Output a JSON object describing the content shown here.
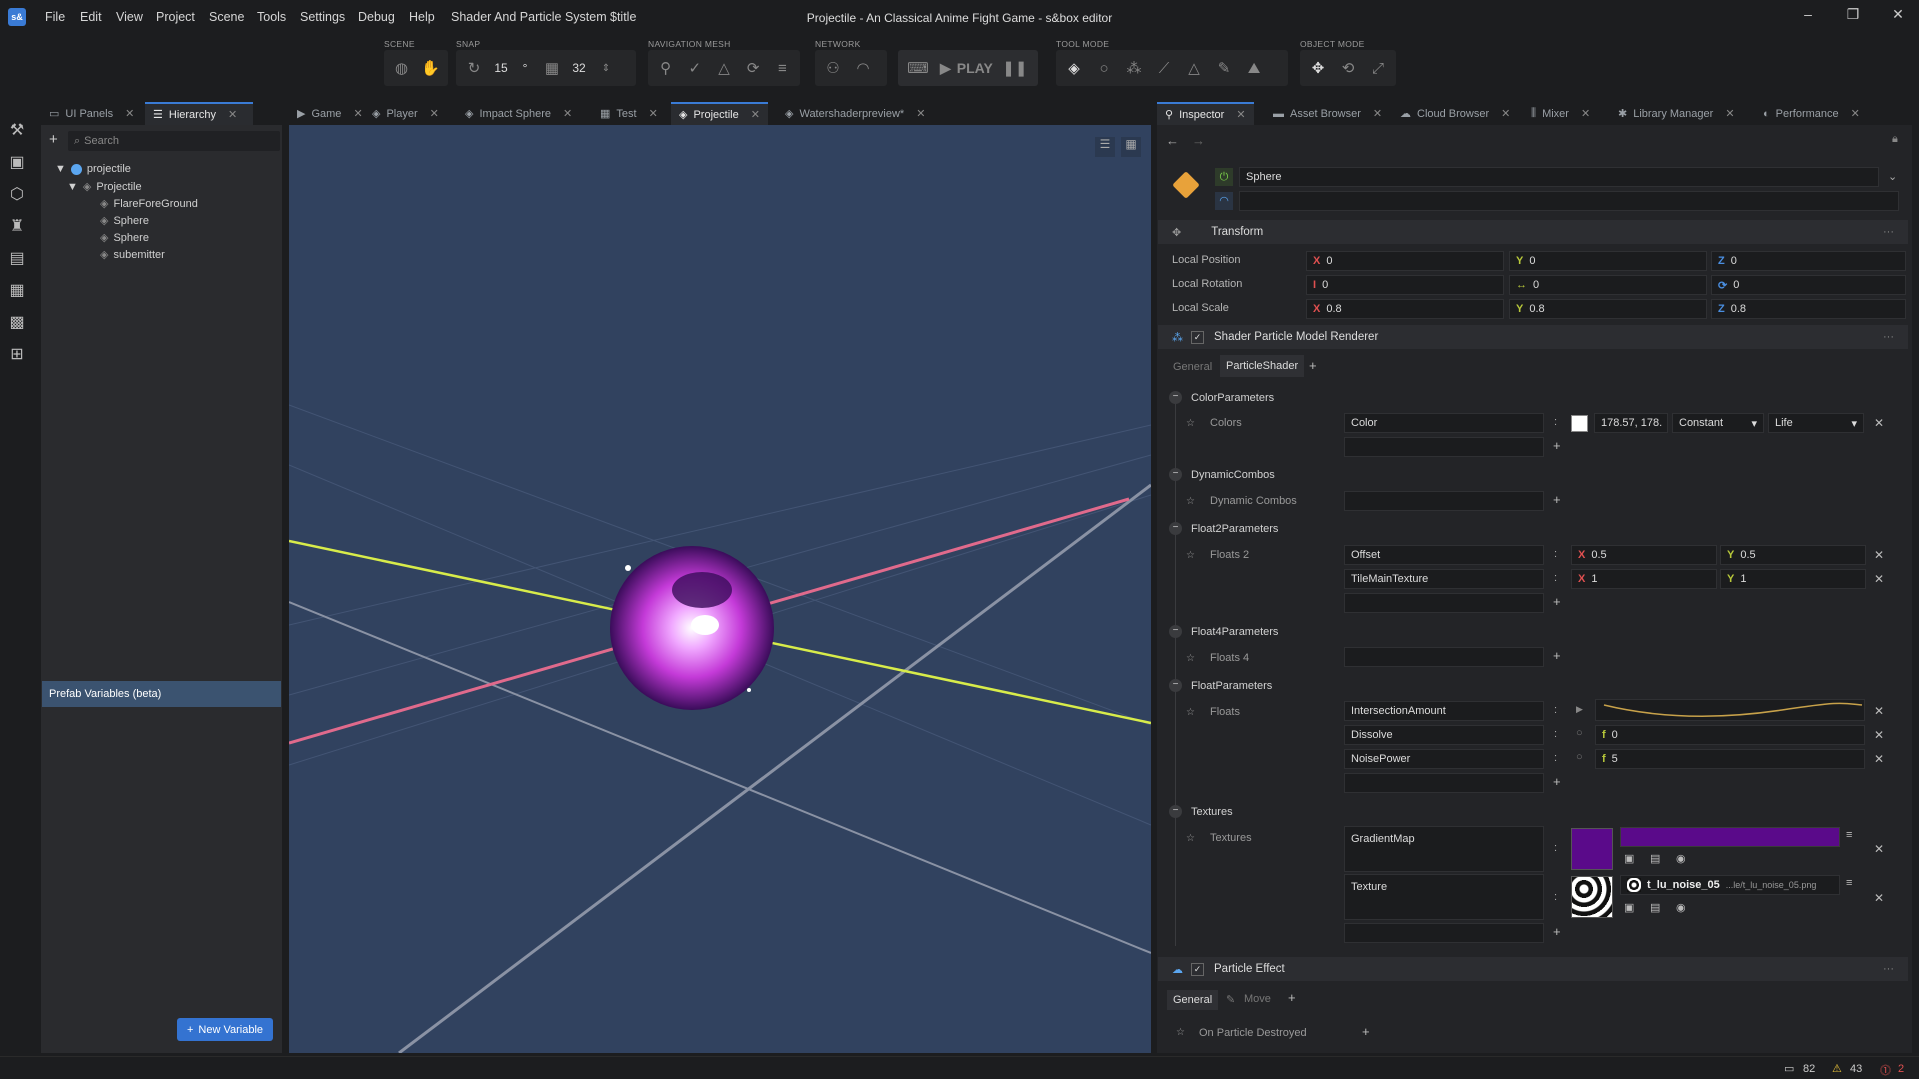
{
  "app": {
    "logo": "s&",
    "title": "Projectile - An Classical Anime Fight Game - s&box editor"
  },
  "menu": [
    "File",
    "Edit",
    "View",
    "Project",
    "Scene",
    "Tools",
    "Settings",
    "Debug",
    "Help",
    "Shader And Particle System",
    "$title"
  ],
  "window_controls": {
    "minimize": "–",
    "maximize": "❐",
    "close": "✕"
  },
  "toolbar": {
    "scene_label": "SCENE",
    "snap_label": "SNAP",
    "snap_angle": "15",
    "snap_deg": "°",
    "snap_grid": "32",
    "navmesh_label": "NAVIGATION MESH",
    "network_label": "NETWORK",
    "play_label": "PLAY",
    "toolmode_label": "TOOL MODE",
    "objectmode_label": "OBJECT MODE"
  },
  "left_tabs": [
    {
      "label": "UI Panels"
    },
    {
      "label": "Hierarchy"
    }
  ],
  "hierarchy": {
    "search_placeholder": "Search",
    "items": [
      "projectile",
      "Projectile",
      "FlareForeGround",
      "Sphere",
      "Sphere",
      "subemitter"
    ],
    "prefab_variables": "Prefab Variables (beta)",
    "new_variable": "New Variable"
  },
  "center_tabs": [
    "Game",
    "Player",
    "Impact Sphere",
    "Test",
    "Projectile",
    "Watershaderpreview*"
  ],
  "right_tabs": [
    "Inspector",
    "Asset Browser",
    "Cloud Browser",
    "Mixer",
    "Library Manager",
    "Performance"
  ],
  "inspector": {
    "object_name": "Sphere",
    "transform": {
      "title": "Transform",
      "rows": [
        {
          "label": "Local Position",
          "x": "0",
          "y": "0",
          "z": "0"
        },
        {
          "label": "Local Rotation",
          "x": "0",
          "y": "0",
          "z": "0"
        },
        {
          "label": "Local Scale",
          "x": "0.8",
          "y": "0.8",
          "z": "0.8"
        }
      ]
    },
    "renderer": {
      "title": "Shader Particle Model Renderer",
      "tabs": [
        "General",
        "ParticleShader"
      ],
      "color_params": {
        "title": "ColorParameters",
        "label": "Colors",
        "name": "Color",
        "value": "178.57, 178.",
        "mode": "Constant",
        "life": "Life"
      },
      "dynamic": {
        "title": "DynamicCombos",
        "label": "Dynamic Combos"
      },
      "float2": {
        "title": "Float2Parameters",
        "label": "Floats 2",
        "rows": [
          {
            "name": "Offset",
            "x": "0.5",
            "y": "0.5"
          },
          {
            "name": "TileMainTexture",
            "x": "1",
            "y": "1"
          }
        ]
      },
      "float4": {
        "title": "Float4Parameters",
        "label": "Floats 4"
      },
      "float": {
        "title": "FloatParameters",
        "label": "Floats",
        "rows": [
          {
            "name": "IntersectionAmount"
          },
          {
            "name": "Dissolve",
            "f": "f",
            "value": "0"
          },
          {
            "name": "NoisePower",
            "f": "f",
            "value": "5"
          }
        ]
      },
      "textures": {
        "title": "Textures",
        "label": "Textures",
        "rows": [
          {
            "name": "GradientMap"
          },
          {
            "name": "Texture",
            "file": "t_lu_noise_05",
            "path": "...le/t_lu_noise_05.png"
          }
        ]
      }
    },
    "particle_effect": {
      "title": "Particle Effect",
      "tabs": [
        "General",
        "Move"
      ],
      "on_destroyed": "On Particle Destroyed"
    }
  },
  "status": {
    "messages": "82",
    "warnings": "43",
    "errors": "2"
  },
  "colors": {
    "accent": "#3a7bd5",
    "viewport": "#31425f",
    "gradient": "#5a0a8a",
    "orb": "#c43ad8"
  }
}
